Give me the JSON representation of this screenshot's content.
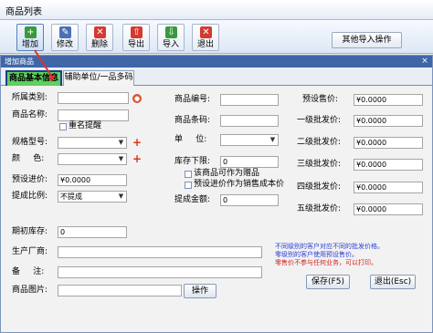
{
  "parent": {
    "title": "商品列表",
    "toolbar": [
      {
        "label": "增加",
        "icon": "add-icon",
        "color": "#3a9a3a"
      },
      {
        "label": "修改",
        "icon": "edit-icon",
        "color": "#4a6fb5"
      },
      {
        "label": "删除",
        "icon": "delete-icon",
        "color": "#d43a2f"
      },
      {
        "label": "导出",
        "icon": "export-icon",
        "color": "#d43a2f"
      },
      {
        "label": "导入",
        "icon": "import-icon",
        "color": "#3a9a3a"
      },
      {
        "label": "退出",
        "icon": "exit-icon",
        "color": "#d43a2f"
      }
    ],
    "other_import_label": "其他导入操作"
  },
  "dialog": {
    "title": "增加商品",
    "close_glyph": "×",
    "tabs": [
      "商品基本信息",
      "辅助单位/一品多码"
    ],
    "labels": {
      "category": "所属类别:",
      "name": "商品名称:",
      "dup_remind": "重名提醒",
      "spec": "规格型号:",
      "color": "颜     色:",
      "preset_purchase": "预设进价:",
      "commission_ratio": "提成比例:",
      "opening_stock": "期初库存:",
      "manufacturer": "生产厂商:",
      "remark": "备     注:",
      "image": "商品图片:",
      "code": "商品编号:",
      "barcode": "商品条码:",
      "unit": "单     位:",
      "stock_lower": "库存下限:",
      "gift_option": "该商品可作为赠品",
      "preset_cost_option": "预设进价作为销售成本价",
      "commission_amount": "提成金额:",
      "preset_sale": "预设售价:",
      "lvl1": "一级批发价:",
      "lvl2": "二级批发价:",
      "lvl3": "三级批发价:",
      "lvl4": "四级批发价:",
      "lvl5": "五级批发价:"
    },
    "values": {
      "preset_purchase": "¥0.0000",
      "commission_ratio": "不提成",
      "opening_stock": "0",
      "stock_lower": "0",
      "commission_amount": "0",
      "preset_sale": "¥0.0000",
      "lvl1": "¥0.0000",
      "lvl2": "¥0.0000",
      "lvl3": "¥0.0000",
      "lvl4": "¥0.0000",
      "lvl5": "¥0.0000"
    },
    "notes": [
      {
        "text": "不同级别的客户对应不同的批发价格。",
        "color": "#2a3fd6"
      },
      {
        "text": "零级别的客户使用预设售价。",
        "color": "#2a3fd6"
      },
      {
        "text": "零售价不参与任何业务，可以打印。",
        "color": "#d42020"
      }
    ],
    "buttons": {
      "browse": "操作",
      "save": "保存(F5)",
      "exit": "退出(Esc)"
    }
  }
}
